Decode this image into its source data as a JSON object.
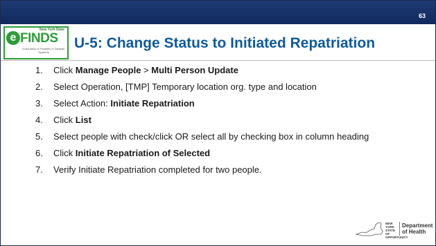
{
  "slide": {
    "page_number": "63",
    "title": "U-5: Change Status to Initiated Repatriation"
  },
  "logo": {
    "top_text": "New York State",
    "letter": "e",
    "word": "FINDS",
    "subtitle": "Evacuation of Facilities In Disaster Systems"
  },
  "steps": [
    {
      "num": "1.",
      "parts": [
        {
          "t": "Click "
        },
        {
          "t": "Manage People",
          "b": true
        },
        {
          "t": " > "
        },
        {
          "t": "Multi Person Update",
          "b": true
        }
      ]
    },
    {
      "num": "2.",
      "parts": [
        {
          "t": "Select Operation, [TMP] Temporary location org. type and location"
        }
      ]
    },
    {
      "num": "3.",
      "parts": [
        {
          "t": "Select Action: "
        },
        {
          "t": "Initiate Repatriation",
          "b": true
        }
      ]
    },
    {
      "num": "4.",
      "parts": [
        {
          "t": "Click "
        },
        {
          "t": "List",
          "b": true
        }
      ]
    },
    {
      "num": "5.",
      "parts": [
        {
          "t": "Select people with check/click OR select all by checking box in column heading"
        }
      ]
    },
    {
      "num": "6.",
      "parts": [
        {
          "t": "Click "
        },
        {
          "t": "Initiate Repatriation of Selected",
          "b": true
        }
      ]
    },
    {
      "num": "7.",
      "parts": [
        {
          "t": "Verify Initiate Repatriation completed for two people."
        }
      ]
    }
  ],
  "footer": {
    "state_text": "NEW YORK STATE OF OPPORTUNITY",
    "department_line1": "Department",
    "department_line2": "of Health"
  },
  "colors": {
    "header_bar": "#102a5c",
    "title": "#0e5a9c",
    "logo_green": "#2e9b3a"
  }
}
